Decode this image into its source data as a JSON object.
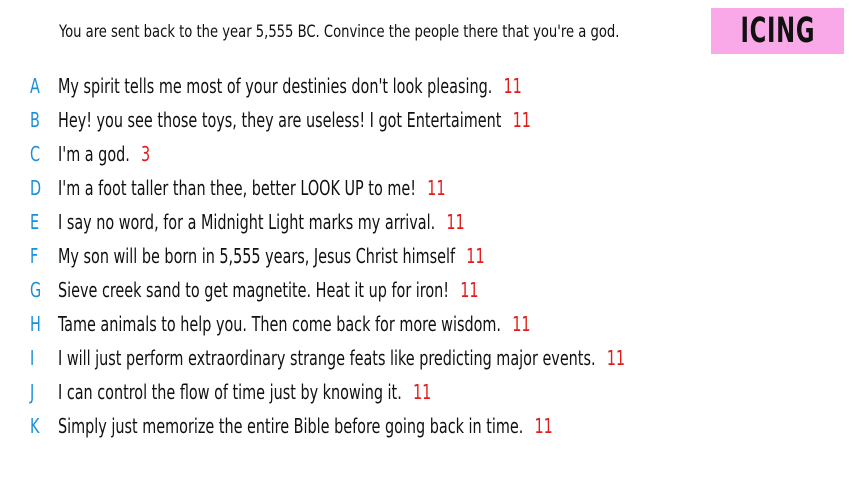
{
  "prompt": "You are sent back to the year 5,555 BC. Convince the people there that you're a god.",
  "badge": "ICING",
  "colors": {
    "letter": "#1a8fd6",
    "score": "#e41b1b",
    "badge_bg": "#f9a8e8"
  },
  "answers": [
    {
      "letter": "A",
      "text": "My spirit tells me most of your destinies don't look pleasing.",
      "score": "11"
    },
    {
      "letter": "B",
      "text": "Hey! you see those toys, they are useless! I got Entertaiment",
      "score": "11"
    },
    {
      "letter": "C",
      "text": "I'm a god.",
      "score": "3"
    },
    {
      "letter": "D",
      "text": "I'm a foot taller than thee, better LOOK UP to me!",
      "score": "11"
    },
    {
      "letter": "E",
      "text": "I say no word, for a Midnight Light marks my arrival.",
      "score": "11"
    },
    {
      "letter": "F",
      "text": "My son will be born in 5,555 years, Jesus Christ himself",
      "score": "11"
    },
    {
      "letter": "G",
      "text": "Sieve creek sand to get magnetite. Heat it up for iron!",
      "score": "11"
    },
    {
      "letter": "H",
      "text": "Tame animals to help you. Then come back for more wisdom.",
      "score": "11"
    },
    {
      "letter": "I",
      "text": "I will just perform extraordinary strange feats like predicting major events.",
      "score": "11"
    },
    {
      "letter": "J",
      "text": "I can control the flow of time just by knowing it.",
      "score": "11"
    },
    {
      "letter": "K",
      "text": "Simply just memorize the entire Bible before going back in time.",
      "score": "11"
    }
  ]
}
